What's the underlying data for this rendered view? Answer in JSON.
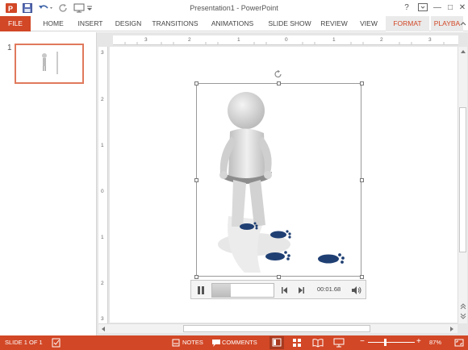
{
  "window": {
    "title": "Presentation1 - PowerPoint",
    "help_label": "?",
    "minimize_label": "—",
    "restore_label": "□",
    "close_label": "✕"
  },
  "ribbon": {
    "tabs": [
      "FILE",
      "HOME",
      "INSERT",
      "DESIGN",
      "TRANSITIONS",
      "ANIMATIONS",
      "SLIDE SHOW",
      "REVIEW",
      "VIEW",
      "FORMAT",
      "PLAYBA"
    ]
  },
  "thumbnails": [
    {
      "number": "1"
    }
  ],
  "rulers": {
    "horizontal": [
      "3",
      "2",
      "1",
      "0",
      "1",
      "2",
      "3"
    ],
    "vertical": [
      "3",
      "2",
      "1",
      "0",
      "1",
      "2",
      "3"
    ]
  },
  "media": {
    "time": "00:01.68",
    "progress": 0.3
  },
  "status": {
    "slide": "SLIDE 1 OF 1",
    "notes": "NOTES",
    "comments": "COMMENTS",
    "zoom": "87%",
    "zoom_minus": "−",
    "zoom_plus": "+"
  },
  "colors": {
    "accent": "#d24726",
    "footprint": "#1f3f73"
  }
}
